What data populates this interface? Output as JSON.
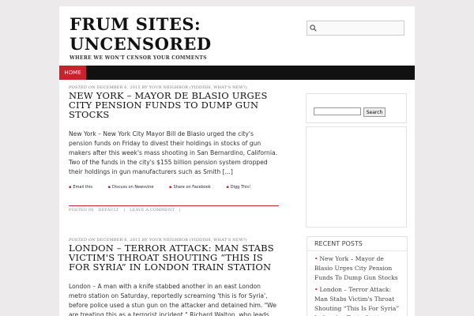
{
  "header": {
    "title_line1": "FRUM SITES:",
    "title_line2": "UNCENSORED",
    "tagline": "WHERE WE WON'T CENSOR YOUR COMMENTS",
    "search_placeholder": ""
  },
  "nav": {
    "home_label": "HOME"
  },
  "posts": [
    {
      "meta_prefix": "POSTED ON",
      "date": "DECEMBER 6, 2015",
      "by": "BY",
      "author": "YOUR NEIGHBOR (YIDDISH, WHAT'S NEW?)",
      "title": "NEW YORK – MAYOR DE BLASIO URGES CITY PENSION FUNDS TO DUMP GUN STOCKS",
      "body": "New York – New York City Mayor Bill de Blasio urged the city's pension funds on Friday to divest their holdings in stocks of gun makers after this week's mass shooting in San Bernardino, California. Two of the funds in the city's $155 billion pension system dropped their holdings in gun manufacturers such as Smith [...]",
      "share": {
        "email": "Email this",
        "newsvine": "Discuss on Newsvine",
        "facebook": "Share on Facebook",
        "digg": "Digg This!"
      },
      "footer_posted_in": "POSTED IN",
      "footer_category": "DEFAULT",
      "footer_sep": "|",
      "footer_comment": "LEAVE A COMMENT",
      "footer_end": "|"
    },
    {
      "meta_prefix": "POSTED ON",
      "date": "DECEMBER 6, 2015",
      "by": "BY",
      "author": "YOUR NEIGHBOR (YIDDISH, WHAT'S NEW?)",
      "title": "LONDON – TERROR ATTACK: MAN STABS VICTIM'S THROAT SHOUTING “THIS IS FOR SYRIA” IN LONDON TRAIN STATION",
      "body": "London – A man with a knife stabbed another in an east London metro station on Saturday, reportedly screaming 'this is for Syria', before police used a stun gun on the attacker and detained him. \"We are treating this as a terrorist incident,\" Richard Walton, who leads the London police's Counter Terrorism Command, said in [...]"
    }
  ],
  "sidebar": {
    "search_button": "Search",
    "search_value": "",
    "recent_heading": "RECENT POSTS",
    "recent_posts": [
      "New York – Mayor de Blasio Urges City Pension Funds To Dump Gun Stocks",
      "London – Terror Attack: Man Stabs Victim's Throat Shouting “This Is For Syria” In London Train Station"
    ]
  },
  "colors": {
    "accent": "#c8232c",
    "navbar": "#111111",
    "background": "#eceaea"
  }
}
